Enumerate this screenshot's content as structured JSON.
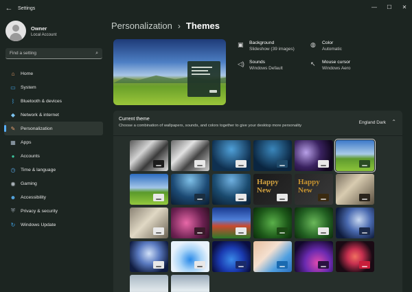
{
  "window": {
    "title": "Settings",
    "back_glyph": "←",
    "minimize_glyph": "—",
    "maximize_glyph": "☐",
    "close_glyph": "✕"
  },
  "profile": {
    "name": "Owner",
    "account_type": "Local Account"
  },
  "search": {
    "placeholder": "Find a setting"
  },
  "nav": {
    "items": [
      {
        "label": "Home",
        "icon": "home-icon",
        "glyph": "⌂",
        "color": "#f0a36b"
      },
      {
        "label": "System",
        "icon": "monitor-icon",
        "glyph": "▭",
        "color": "#3fa3e6"
      },
      {
        "label": "Bluetooth & devices",
        "icon": "bluetooth-icon",
        "glyph": "ᛒ",
        "color": "#3fa3e6"
      },
      {
        "label": "Network & internet",
        "icon": "wifi-icon",
        "glyph": "◆",
        "color": "#7cc3f0"
      },
      {
        "label": "Personalization",
        "icon": "brush-icon",
        "glyph": "✎",
        "color": "#e8a070",
        "active": true
      },
      {
        "label": "Apps",
        "icon": "apps-icon",
        "glyph": "▦",
        "color": "#a9b8c8"
      },
      {
        "label": "Accounts",
        "icon": "accounts-icon",
        "glyph": "●",
        "color": "#3cc29a"
      },
      {
        "label": "Time & language",
        "icon": "clock-icon",
        "glyph": "◷",
        "color": "#5aa8e8"
      },
      {
        "label": "Gaming",
        "icon": "gamepad-icon",
        "glyph": "◉",
        "color": "#b8c0c8"
      },
      {
        "label": "Accessibility",
        "icon": "accessibility-icon",
        "glyph": "☻",
        "color": "#5ab0f0"
      },
      {
        "label": "Privacy & security",
        "icon": "shield-icon",
        "glyph": "⛨",
        "color": "#9aa4ae"
      },
      {
        "label": "Windows Update",
        "icon": "update-icon",
        "glyph": "↻",
        "color": "#3fa3e6"
      }
    ]
  },
  "breadcrumb": {
    "parent": "Personalization",
    "separator": "›",
    "current": "Themes"
  },
  "properties": [
    {
      "label": "Background",
      "value": "Slideshow (39 images)",
      "icon": "image-icon",
      "glyph": "▣"
    },
    {
      "label": "Color",
      "value": "Automatic",
      "icon": "palette-icon",
      "glyph": "◍"
    },
    {
      "label": "Sounds",
      "value": "Windows Default",
      "icon": "speaker-icon",
      "glyph": "◁)"
    },
    {
      "label": "Mouse cursor",
      "value": "Windows Aero",
      "icon": "cursor-icon",
      "glyph": "↖"
    }
  ],
  "current_theme": {
    "title": "Current theme",
    "description": "Choose a combination of wallpapers, sounds, and colors together to give your desktop more personality",
    "value": "England Dark",
    "chevron_glyph": "⌃"
  },
  "themes": [
    {
      "bg": "linear-gradient(135deg,#5a5a5a,#d4d4d4 35%,#3a3a3a 60%,#e0e0e0)",
      "swatch": "#1c1c1c"
    },
    {
      "bg": "linear-gradient(135deg,#6a6a6a,#e2e2e2 35%,#444 60%,#cfcfcf)",
      "swatch": "#e8e8e8",
      "light": true
    },
    {
      "bg": "radial-gradient(circle at 50% 30%,#4fa0d8,#0f3050 70%)",
      "swatch": "#e8e8e8",
      "light": true
    },
    {
      "bg": "radial-gradient(circle at 50% 30%,#3a86bb,#0a2540 70%)",
      "swatch": "#1f4a6a"
    },
    {
      "bg": "radial-gradient(circle at 30% 40%,#b8a0e8,#3a2260 45%,#120820 80%)",
      "swatch": "#e8e8e8",
      "light": true
    },
    {
      "bg": "linear-gradient(180deg,#3c78c8,#a9cbe8 45%,#5e9a2e 60%,#8cc43a)",
      "swatch": "#2a4a22",
      "selected": true
    },
    {
      "bg": "linear-gradient(180deg,#2c6cc0,#a2c5e8 45%,#5a9a2a 60%,#94c83e)",
      "swatch": "#e8e8e8",
      "light": true
    },
    {
      "bg": "radial-gradient(circle at 50% 20%,#7fc0e8,#1c4a74 55%,#0a1c30)",
      "swatch": "#1a2e40"
    },
    {
      "bg": "radial-gradient(circle at 50% 20%,#6fb0e0,#1a4a6e 55%,#0a1a2c)",
      "swatch": "#e8e8e8",
      "light": true
    },
    {
      "bg": "linear-gradient(135deg,#1a1a1a,#2a2a2a)",
      "swatch": "#e8e8e8",
      "light": true,
      "text": "Happy\nNew",
      "text_color": "#d4a340"
    },
    {
      "bg": "linear-gradient(135deg,#262626,#3a3a3a)",
      "swatch": "#3a2a10",
      "text": "Happy\nNew",
      "text_color": "#c89430"
    },
    {
      "bg": "linear-gradient(135deg,#7a7060,#d8cbb0 40%,#5a5040)",
      "swatch": "#2a241c"
    },
    {
      "bg": "linear-gradient(135deg,#8a8274,#e0d8c4 45%,#6a6254)",
      "swatch": "#e8e8e8",
      "light": true
    },
    {
      "bg": "radial-gradient(circle at 40% 50%,#e868a8,#6a2050 60%,#2a1020)",
      "swatch": "#3a1a2a"
    },
    {
      "bg": "linear-gradient(180deg,#1a3a90,#4f7fd8 40%,#c84a30 60%,#2a7a2a)",
      "swatch": "#e8e8e8",
      "light": true
    },
    {
      "bg": "radial-gradient(circle at 50% 50%,#5ab04a,#1e5a1a 60%,#0a2a0a)",
      "swatch": "#1c4a14"
    },
    {
      "bg": "radial-gradient(circle at 50% 50%,#6ab85a,#226022 60%,#0c2a0c)",
      "swatch": "#e8e8e8",
      "light": true
    },
    {
      "bg": "radial-gradient(circle at 60% 40%,#c8d8f0,#4a6ab0 40%,#0e1a3a 80%)",
      "swatch": "#1c2a4a"
    },
    {
      "bg": "radial-gradient(circle at 50% 40%,#d0e0f8,#5a7ac0 40%,#101c40 80%)",
      "swatch": "#e8e8e8",
      "light": true
    },
    {
      "bg": "radial-gradient(circle at 50% 60%,#2a8ae8,#a8d4f8 40%,#e8f2fc 70%)",
      "swatch": "#e8e8e8",
      "light": true
    },
    {
      "bg": "radial-gradient(circle at 50% 60%,#3a8ae8,#1a3ab0 45%,#0a0e40 80%)",
      "swatch": "#1a2a6a"
    },
    {
      "bg": "linear-gradient(135deg,#e8c0a0,#f4e0d0 40%,#50a0e0 70%,#2a70c0)",
      "swatch": "#1a6ab0"
    },
    {
      "bg": "radial-gradient(circle at 60% 70%,#e04ab0,#6a2ab0 40%,#12082a 80%)",
      "swatch": "#2a1240"
    },
    {
      "bg": "radial-gradient(circle at 50% 50%,#f07060,#c83050 30%,#1a0a14 70%)",
      "swatch": "#c81e3a"
    },
    {
      "bg": "linear-gradient(180deg,#a8b8c4,#dfe6ea 50%,#8a9aa4)",
      "swatch": "#e8e8e8",
      "light": true
    },
    {
      "bg": "linear-gradient(180deg,#98a8b8,#e4ecf0 50%,#7a8a98)",
      "swatch": "#e8e8e8",
      "light": true
    }
  ]
}
